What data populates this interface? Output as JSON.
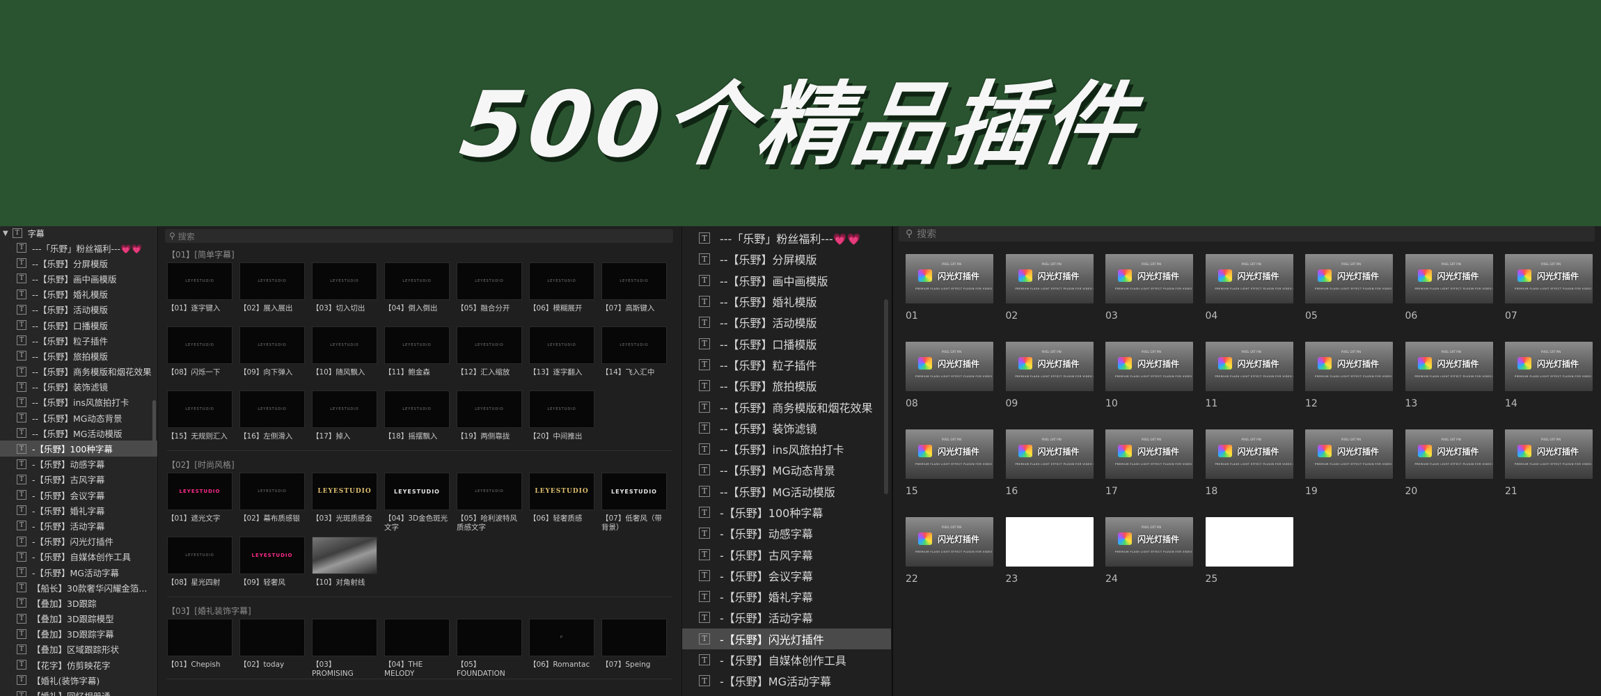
{
  "banner": {
    "title": "500个精品插件"
  },
  "sidebar": {
    "root_label": "字幕",
    "items": [
      {
        "label": "---「乐野」粉丝福利---💗💗"
      },
      {
        "label": "--【乐野】分屏模版"
      },
      {
        "label": "--【乐野】画中画模版"
      },
      {
        "label": "--【乐野】婚礼模版"
      },
      {
        "label": "--【乐野】活动模版"
      },
      {
        "label": "--【乐野】口播模版"
      },
      {
        "label": "--【乐野】粒子插件"
      },
      {
        "label": "--【乐野】旅拍模版"
      },
      {
        "label": "--【乐野】商务模版和烟花效果"
      },
      {
        "label": "--【乐野】装饰滤镜"
      },
      {
        "label": "--【乐野】ins风旅拍打卡"
      },
      {
        "label": "--【乐野】MG动态背景"
      },
      {
        "label": "--【乐野】MG活动模版"
      },
      {
        "label": "-【乐野】100种字幕",
        "selected": true
      },
      {
        "label": "-【乐野】动感字幕"
      },
      {
        "label": "-【乐野】古风字幕"
      },
      {
        "label": "-【乐野】会议字幕"
      },
      {
        "label": "-【乐野】婚礼字幕"
      },
      {
        "label": "-【乐野】活动字幕"
      },
      {
        "label": "-【乐野】闪光灯插件"
      },
      {
        "label": "-【乐野】自媒体创作工具"
      },
      {
        "label": "-【乐野】MG活动字幕"
      },
      {
        "label": "【船长】30款奢华闪耀金箔..."
      },
      {
        "label": "【叠加】3D跟踪"
      },
      {
        "label": "【叠加】3D跟踪模型"
      },
      {
        "label": "【叠加】3D跟踪字幕"
      },
      {
        "label": "【叠加】区域跟踪形状"
      },
      {
        "label": "【花字】仿剪映花字"
      },
      {
        "label": "【婚礼(装饰字幕)"
      },
      {
        "label": "【婚礼】回忆相册通"
      }
    ]
  },
  "browser": {
    "search_placeholder": "搜索",
    "sections": [
      {
        "title": "【01】[简单字幕]",
        "tiles": [
          {
            "label": "【01】逐字键入",
            "thumb": "LEYESTUDIO"
          },
          {
            "label": "【02】展入展出",
            "thumb": "LEYESTUDIO"
          },
          {
            "label": "【03】切入切出",
            "thumb": "LEYESTUDIO"
          },
          {
            "label": "【04】倒入倒出",
            "thumb": "LEYESTUDIO"
          },
          {
            "label": "【05】融合分开",
            "thumb": "LEYESTUDIO"
          },
          {
            "label": "【06】模糊展开",
            "thumb": "LEYESTUDIO"
          },
          {
            "label": "【07】高斯键入",
            "thumb": "LEYESTUDIO"
          },
          {
            "label": "【08】闪烁一下",
            "thumb": "LEYESTUDIO"
          },
          {
            "label": "【09】向下弹入",
            "thumb": "LEYESTUDIO"
          },
          {
            "label": "【10】随风飘入",
            "thumb": "LEYESTUDIO"
          },
          {
            "label": "【11】鲍金森",
            "thumb": "LEYESTUDIO"
          },
          {
            "label": "【12】汇入缩放",
            "thumb": "LEYESTUDIO"
          },
          {
            "label": "【13】逐字翻入",
            "thumb": "LEYESTUDIO"
          },
          {
            "label": "【14】飞入汇中",
            "thumb": "LEYESTUDIO"
          },
          {
            "label": "【15】无规则汇入",
            "thumb": "LEYESTUDIO"
          },
          {
            "label": "【16】左侧滑入",
            "thumb": "LEYESTUDIO"
          },
          {
            "label": "【17】掉入",
            "thumb": "LEYESTUDIO"
          },
          {
            "label": "【18】摇摆飘入",
            "thumb": "LEYESTUDIO"
          },
          {
            "label": "【19】两侧靠拢",
            "thumb": "LEYESTUDIO"
          },
          {
            "label": "【20】中间推出",
            "thumb": "LEYESTUDIO"
          }
        ]
      },
      {
        "title": "【02】[时尚风格]",
        "tiles": [
          {
            "label": "【01】遮光文字",
            "thumb": "LEYESTUDIO",
            "style": "logo-pink"
          },
          {
            "label": "【02】幕布质感银",
            "thumb": "LEYESTUDIO"
          },
          {
            "label": "【03】光斑质感金",
            "thumb": "LEYESTUDIO",
            "style": "logo-gold"
          },
          {
            "label": "【04】3D金色斑光文字",
            "thumb": "LEYESTUDIO",
            "style": "logo-white"
          },
          {
            "label": "【05】哈利波特风质感文字",
            "thumb": "LEYESTUDIO"
          },
          {
            "label": "【06】轻奢质感",
            "thumb": "LEYESTUDIO",
            "style": "logo-gold"
          },
          {
            "label": "【07】低奢风（带背景）",
            "thumb": "LEYESTUDIO",
            "style": "logo-white"
          },
          {
            "label": "【08】星光四射",
            "thumb": "LEYESTUDIO"
          },
          {
            "label": "【09】轻奢风",
            "thumb": "LEYESTUDIO",
            "style": "logo-pink"
          },
          {
            "label": "【10】对角射线",
            "thumb": "",
            "style": "photo"
          }
        ]
      },
      {
        "title": "【03】[婚礼装饰字幕]",
        "tiles": [
          {
            "label": "【01】Chepish",
            "thumb": ""
          },
          {
            "label": "【02】today",
            "thumb": ""
          },
          {
            "label": "【03】PROMISING",
            "thumb": ""
          },
          {
            "label": "【04】THE MELODY",
            "thumb": ""
          },
          {
            "label": "【05】FOUNDATION",
            "thumb": ""
          },
          {
            "label": "【06】Romantac",
            "thumb": "P"
          },
          {
            "label": "【07】Speing",
            "thumb": ""
          }
        ]
      }
    ]
  },
  "list": {
    "items": [
      {
        "label": "---「乐野」粉丝福利---💗💗"
      },
      {
        "label": "--【乐野】分屏模版"
      },
      {
        "label": "--【乐野】画中画模版"
      },
      {
        "label": "--【乐野】婚礼模版"
      },
      {
        "label": "--【乐野】活动模版"
      },
      {
        "label": "--【乐野】口播模版"
      },
      {
        "label": "--【乐野】粒子插件"
      },
      {
        "label": "--【乐野】旅拍模版"
      },
      {
        "label": "--【乐野】商务模版和烟花效果"
      },
      {
        "label": "--【乐野】装饰滤镜"
      },
      {
        "label": "--【乐野】ins风旅拍打卡"
      },
      {
        "label": "--【乐野】MG动态背景"
      },
      {
        "label": "--【乐野】MG活动模版"
      },
      {
        "label": "-【乐野】100种字幕"
      },
      {
        "label": "-【乐野】动感字幕"
      },
      {
        "label": "-【乐野】古风字幕"
      },
      {
        "label": "-【乐野】会议字幕"
      },
      {
        "label": "-【乐野】婚礼字幕"
      },
      {
        "label": "-【乐野】活动字幕"
      },
      {
        "label": "-【乐野】闪光灯插件",
        "selected": true
      },
      {
        "label": "-【乐野】自媒体创作工具"
      },
      {
        "label": "-【乐野】MG活动字幕"
      }
    ]
  },
  "grid": {
    "search_placeholder": "搜索",
    "thumb_title": "闪光灯插件",
    "thumb_top": "PIXEL GRT PIN",
    "thumb_sub": "PREMIUM FLASH LIGHT EFFECT PLUGIN FOR VIDEO EDITING",
    "tiles": [
      {
        "label": "01"
      },
      {
        "label": "02"
      },
      {
        "label": "03"
      },
      {
        "label": "04"
      },
      {
        "label": "05"
      },
      {
        "label": "06"
      },
      {
        "label": "07"
      },
      {
        "label": "08"
      },
      {
        "label": "09"
      },
      {
        "label": "10"
      },
      {
        "label": "11"
      },
      {
        "label": "12"
      },
      {
        "label": "13"
      },
      {
        "label": "14"
      },
      {
        "label": "15"
      },
      {
        "label": "16"
      },
      {
        "label": "17"
      },
      {
        "label": "18"
      },
      {
        "label": "19"
      },
      {
        "label": "20"
      },
      {
        "label": "21"
      },
      {
        "label": "22"
      },
      {
        "label": "23",
        "white": true
      },
      {
        "label": "24"
      },
      {
        "label": "25",
        "white": true
      }
    ]
  }
}
